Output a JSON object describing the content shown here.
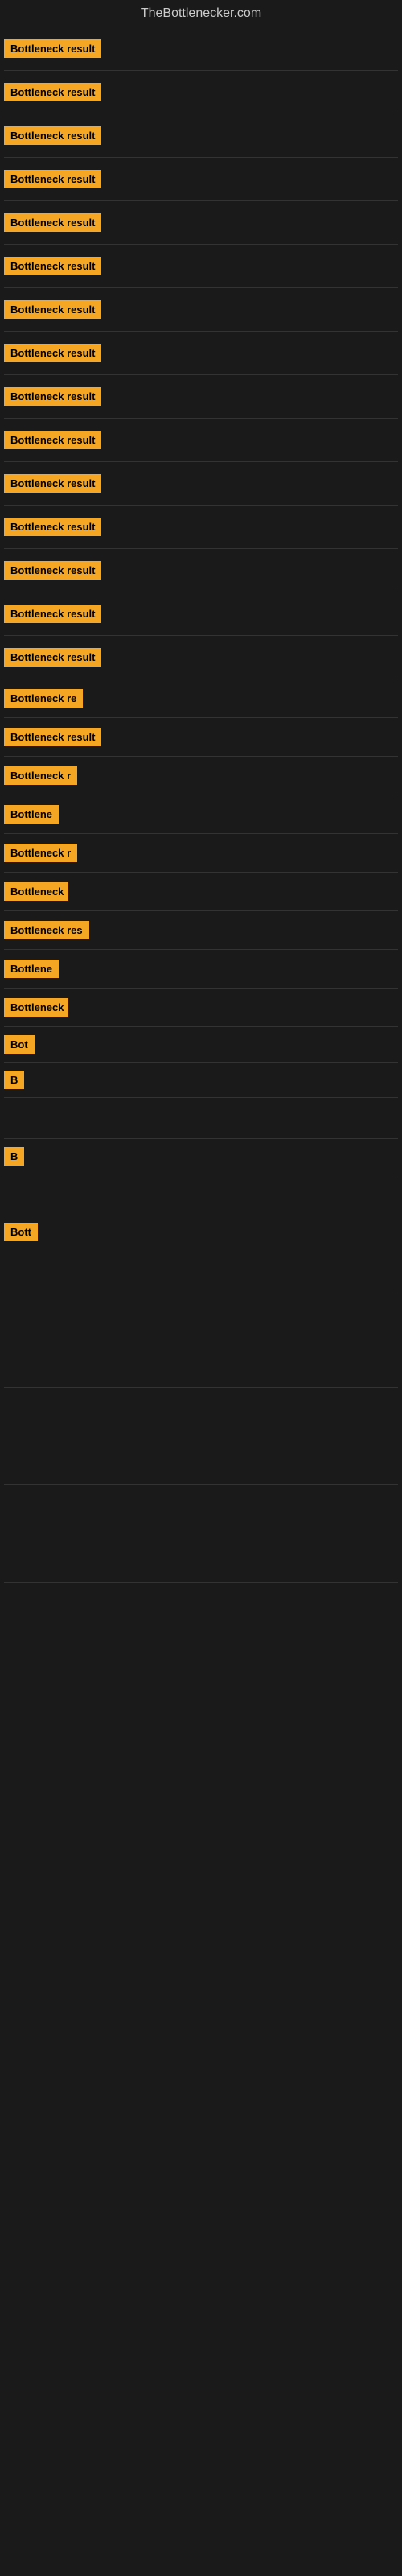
{
  "header": {
    "title": "TheBottlenecker.com"
  },
  "items": [
    {
      "id": 1,
      "label": "Bottleneck result",
      "width_class": "w-full",
      "spacing": 15
    },
    {
      "id": 2,
      "label": "Bottleneck result",
      "width_class": "w-full",
      "spacing": 15
    },
    {
      "id": 3,
      "label": "Bottleneck result",
      "width_class": "w-full",
      "spacing": 15
    },
    {
      "id": 4,
      "label": "Bottleneck result",
      "width_class": "w-full",
      "spacing": 15
    },
    {
      "id": 5,
      "label": "Bottleneck result",
      "width_class": "w-full",
      "spacing": 15
    },
    {
      "id": 6,
      "label": "Bottleneck result",
      "width_class": "w-full",
      "spacing": 15
    },
    {
      "id": 7,
      "label": "Bottleneck result",
      "width_class": "w-full",
      "spacing": 15
    },
    {
      "id": 8,
      "label": "Bottleneck result",
      "width_class": "w-full",
      "spacing": 15
    },
    {
      "id": 9,
      "label": "Bottleneck result",
      "width_class": "w-full",
      "spacing": 15
    },
    {
      "id": 10,
      "label": "Bottleneck result",
      "width_class": "w-full",
      "spacing": 15
    },
    {
      "id": 11,
      "label": "Bottleneck result",
      "width_class": "w-full",
      "spacing": 15
    },
    {
      "id": 12,
      "label": "Bottleneck result",
      "width_class": "w-full",
      "spacing": 15
    },
    {
      "id": 13,
      "label": "Bottleneck result",
      "width_class": "w-full",
      "spacing": 15
    },
    {
      "id": 14,
      "label": "Bottleneck result",
      "width_class": "w-full",
      "spacing": 15
    },
    {
      "id": 15,
      "label": "Bottleneck result",
      "width_class": "w-full",
      "spacing": 15
    },
    {
      "id": 16,
      "label": "Bottleneck re",
      "width_class": "w-large",
      "spacing": 12
    },
    {
      "id": 17,
      "label": "Bottleneck result",
      "width_class": "w-full",
      "spacing": 12
    },
    {
      "id": 18,
      "label": "Bottleneck r",
      "width_class": "w-medium",
      "spacing": 12
    },
    {
      "id": 19,
      "label": "Bottlene",
      "width_class": "w-small",
      "spacing": 12
    },
    {
      "id": 20,
      "label": "Bottleneck r",
      "width_class": "w-medium",
      "spacing": 12
    },
    {
      "id": 21,
      "label": "Bottleneck",
      "width_class": "w-small",
      "spacing": 12
    },
    {
      "id": 22,
      "label": "Bottleneck res",
      "width_class": "w-large",
      "spacing": 12
    },
    {
      "id": 23,
      "label": "Bottlene",
      "width_class": "w-small",
      "spacing": 12
    },
    {
      "id": 24,
      "label": "Bottleneck",
      "width_class": "w-small",
      "spacing": 12
    },
    {
      "id": 25,
      "label": "Bot",
      "width_class": "w-xsmall",
      "spacing": 10
    },
    {
      "id": 26,
      "label": "B",
      "width_class": "w-xxsmall",
      "spacing": 10
    },
    {
      "id": 27,
      "label": "",
      "width_class": "w-xxxsmall",
      "spacing": 25
    },
    {
      "id": 28,
      "label": "B",
      "width_class": "w-xxsmall",
      "spacing": 10
    },
    {
      "id": 29,
      "label": "Bott",
      "width_class": "w-xsmall",
      "spacing": 60
    },
    {
      "id": 30,
      "label": "",
      "width_class": "w-xxxsmall",
      "spacing": 60
    },
    {
      "id": 31,
      "label": "",
      "width_class": "w-xxxsmall",
      "spacing": 60
    },
    {
      "id": 32,
      "label": "",
      "width_class": "w-xxxsmall",
      "spacing": 60
    }
  ]
}
